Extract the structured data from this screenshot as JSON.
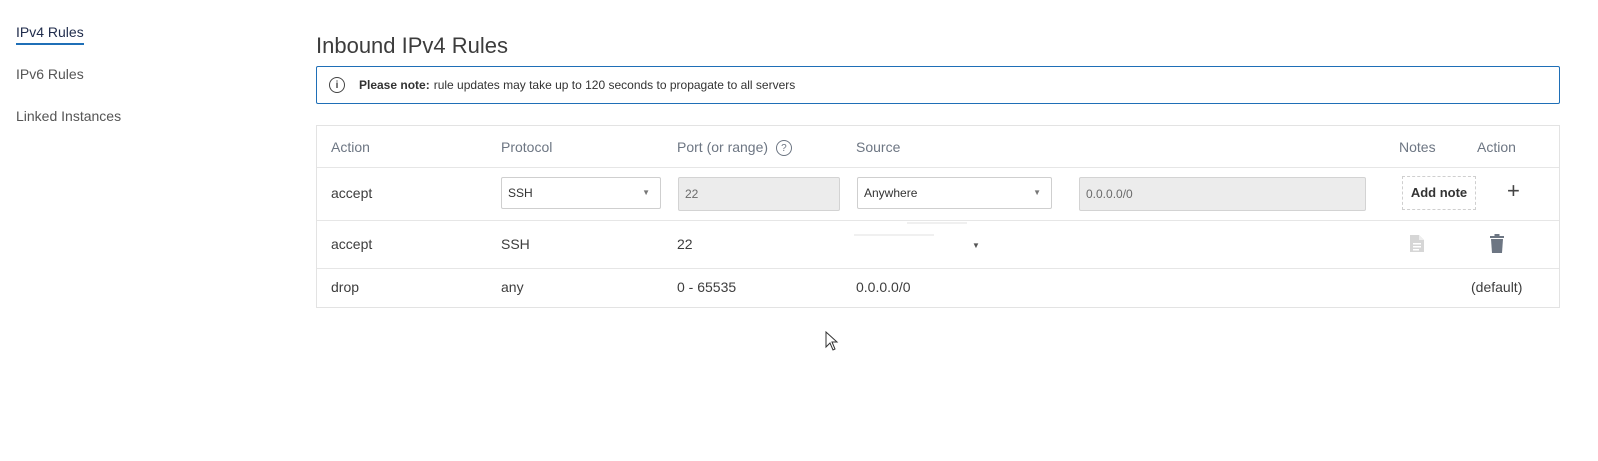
{
  "sidebar": {
    "items": [
      {
        "label": "IPv4 Rules",
        "active": true
      },
      {
        "label": "IPv6 Rules",
        "active": false
      },
      {
        "label": "Linked Instances",
        "active": false
      }
    ]
  },
  "page": {
    "title": "Inbound IPv4 Rules"
  },
  "notice": {
    "bold": "Please note:",
    "text": "rule updates may take up to 120 seconds to propagate to all servers"
  },
  "table": {
    "headers": {
      "action": "Action",
      "protocol": "Protocol",
      "port": "Port (or range)",
      "source": "Source",
      "notes": "Notes",
      "action2": "Action"
    },
    "edit_row": {
      "action": "accept",
      "protocol": "SSH",
      "port": "22",
      "source": "Anywhere",
      "cidr": "0.0.0.0/0",
      "add_note": "Add note",
      "add_symbol": "+"
    },
    "rows": [
      {
        "action": "accept",
        "protocol": "SSH",
        "port": "22",
        "source": "",
        "note_icon": "document-icon",
        "delete_icon": "trash-icon"
      },
      {
        "action": "drop",
        "protocol": "any",
        "port": "0 - 65535",
        "source": "0.0.0.0/0",
        "default": "(default)"
      }
    ]
  },
  "colors": {
    "accent": "#1f6fb7"
  }
}
